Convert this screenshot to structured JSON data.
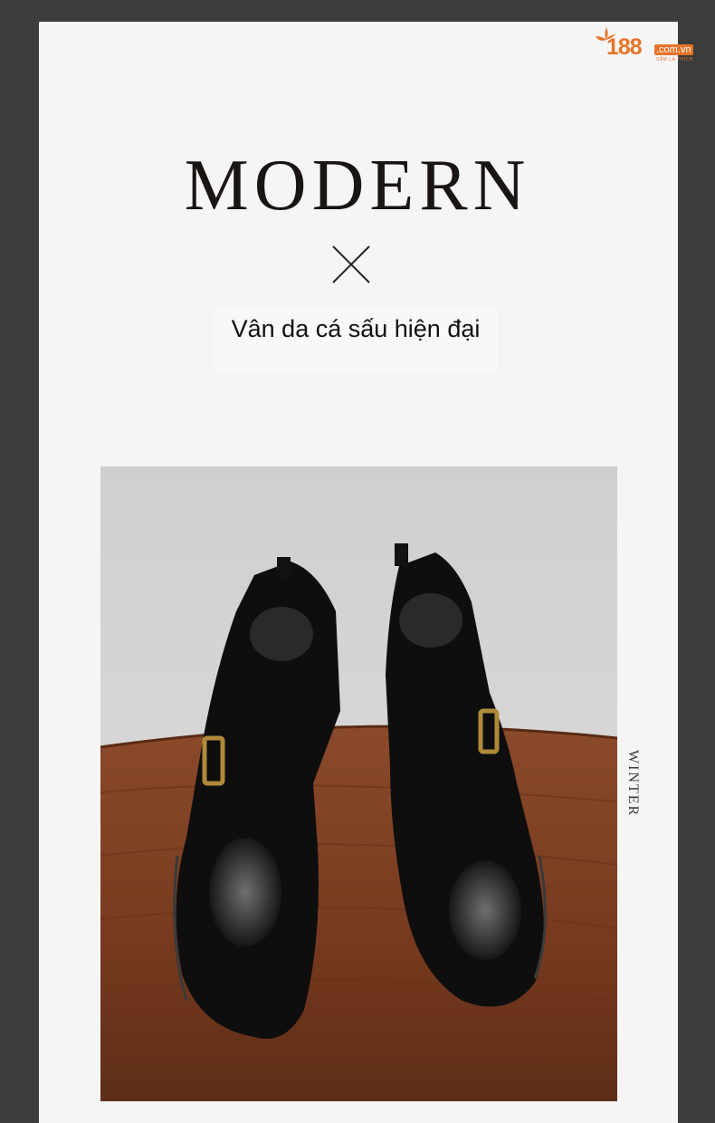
{
  "logo": {
    "number": "188",
    "domain": ".com.vn",
    "tagline": "SẮM LÀ THÍCH"
  },
  "heading": {
    "title": "MODERN",
    "subtitle": "Vân da cá sấu hiện đại"
  },
  "photo": {
    "subject": "boots-image",
    "side_label": "WINTER"
  },
  "colors": {
    "background": "#3b3d3b",
    "card": "#f5f5f5",
    "brand": "#e8742a",
    "title": "#1a1412"
  }
}
